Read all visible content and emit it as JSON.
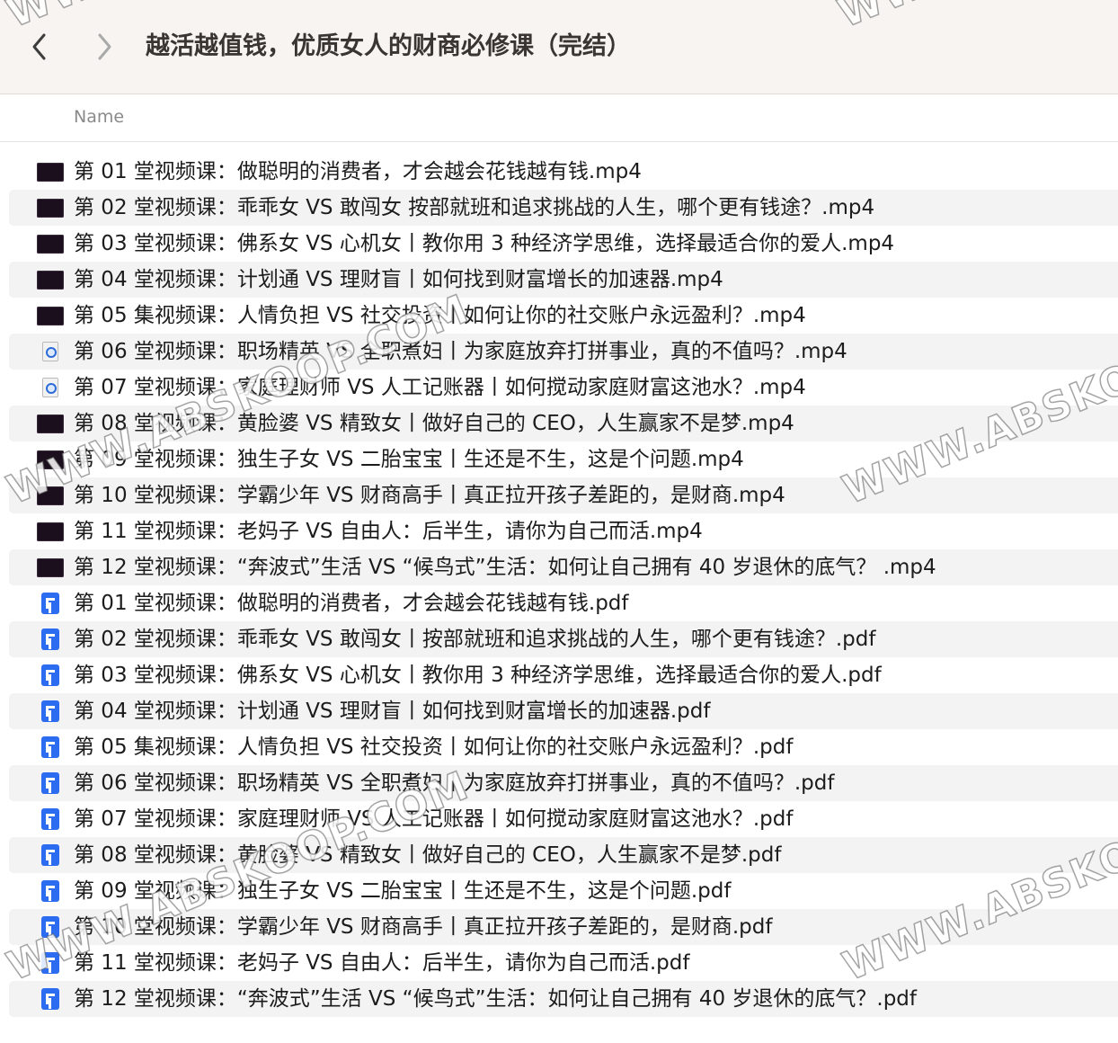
{
  "toolbar": {
    "back_icon": "chevron-left-icon",
    "forward_icon": "chevron-right-icon",
    "title": "越活越值钱，优质女人的财商必修课（完结）"
  },
  "header": {
    "name_column": "Name"
  },
  "files": [
    {
      "name": "第 01 堂视频课：做聪明的消费者，才会越会花钱越有钱.mp4",
      "icon": "video-thumbnail"
    },
    {
      "name": "第 02 堂视频课：乖乖女 VS 敢闯女 按部就班和追求挑战的人生，哪个更有钱途？.mp4",
      "icon": "video-thumbnail"
    },
    {
      "name": "第 03 堂视频课：佛系女 VS 心机女丨教你用 3 种经济学思维，选择最适合你的爱人.mp4",
      "icon": "video-thumbnail"
    },
    {
      "name": "第 04 堂视频课：计划通 VS 理财盲丨如何找到财富增长的加速器.mp4",
      "icon": "video-thumbnail"
    },
    {
      "name": "第 05 集视频课：人情负担 VS 社交投资丨如何让你的社交账户永远盈利？.mp4",
      "icon": "video-thumbnail"
    },
    {
      "name": "第 06 堂视频课：职场精英 VS 全职煮妇丨为家庭放弃打拼事业，真的不值吗？.mp4",
      "icon": "quicktime-file"
    },
    {
      "name": "第 07 堂视频课：家庭理财师 VS 人工记账器丨如何搅动家庭财富这池水？.mp4",
      "icon": "quicktime-file"
    },
    {
      "name": "第 08 堂视频课：黄脸婆 VS 精致女丨做好自己的 CEO，人生赢家不是梦.mp4",
      "icon": "video-thumbnail"
    },
    {
      "name": "第 09 堂视频课：独生子女 VS 二胎宝宝丨生还是不生，这是个问题.mp4",
      "icon": "video-thumbnail"
    },
    {
      "name": "第 10 堂视频课：学霸少年 VS 财商高手丨真正拉开孩子差距的，是财商.mp4",
      "icon": "video-thumbnail"
    },
    {
      "name": "第 11 堂视频课：老妈子 VS 自由人：后半生，请你为自己而活.mp4",
      "icon": "video-thumbnail"
    },
    {
      "name": "第 12 堂视频课：“奔波式”生活 VS “候鸟式”生活：如何让自己拥有 40 岁退休的底气？ .mp4",
      "icon": "video-thumbnail"
    },
    {
      "name": "第 01 堂视频课：做聪明的消费者，才会越会花钱越有钱.pdf",
      "icon": "pdf-file"
    },
    {
      "name": "第 02 堂视频课：乖乖女 VS 敢闯女丨按部就班和追求挑战的人生，哪个更有钱途？.pdf",
      "icon": "pdf-file"
    },
    {
      "name": "第 03 堂视频课：佛系女 VS 心机女丨教你用 3 种经济学思维，选择最适合你的爱人.pdf",
      "icon": "pdf-file"
    },
    {
      "name": "第 04 堂视频课：计划通 VS 理财盲丨如何找到财富增长的加速器.pdf",
      "icon": "pdf-file"
    },
    {
      "name": "第 05 集视频课：人情负担 VS 社交投资丨如何让你的社交账户永远盈利？.pdf",
      "icon": "pdf-file"
    },
    {
      "name": "第 06 堂视频课：职场精英 VS 全职煮妇丨为家庭放弃打拼事业，真的不值吗？.pdf",
      "icon": "pdf-file"
    },
    {
      "name": "第 07 堂视频课：家庭理财师 VS 人工记账器丨如何搅动家庭财富这池水？.pdf",
      "icon": "pdf-file"
    },
    {
      "name": "第 08 堂视频课：黄脸婆 VS 精致女丨做好自己的 CEO，人生赢家不是梦.pdf",
      "icon": "pdf-file"
    },
    {
      "name": "第 09 堂视频课：独生子女 VS 二胎宝宝丨生还是不生，这是个问题.pdf",
      "icon": "pdf-file"
    },
    {
      "name": "第 10 堂视频课：学霸少年 VS 财商高手丨真正拉开孩子差距的，是财商.pdf",
      "icon": "pdf-file"
    },
    {
      "name": "第 11 堂视频课：老妈子 VS 自由人：后半生，请你为自己而活.pdf",
      "icon": "pdf-file"
    },
    {
      "name": "第 12 堂视频课：“奔波式”生活 VS “候鸟式”生活：如何让自己拥有 40 岁退休的底气？.pdf",
      "icon": "pdf-file"
    }
  ],
  "watermark": "WWW.ABSKOOP.COM"
}
